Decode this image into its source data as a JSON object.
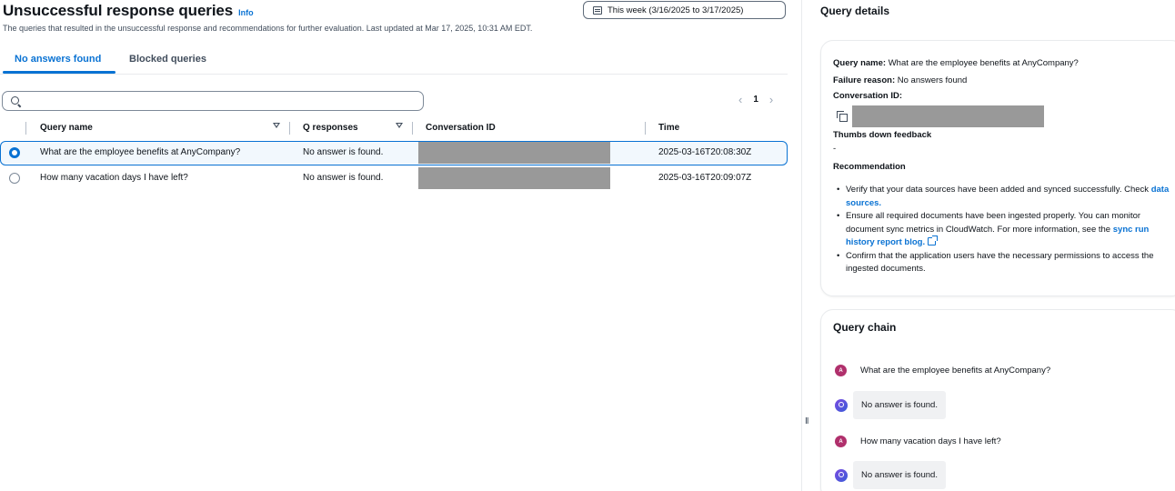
{
  "header": {
    "title": "Unsuccessful response queries",
    "info_label": "Info",
    "subtitle": "The queries that resulted in the unsuccessful response and recommendations for further evaluation. Last updated at Mar 17, 2025, 10:31 AM EDT.",
    "date_range_label": "This week (3/16/2025 to 3/17/2025)"
  },
  "tabs": [
    {
      "label": "No answers found",
      "active": true
    },
    {
      "label": "Blocked queries",
      "active": false
    }
  ],
  "search": {
    "placeholder": "",
    "value": ""
  },
  "pagination": {
    "prev": "‹",
    "page": "1",
    "next": "›"
  },
  "table": {
    "columns": [
      "Query name",
      "Q responses",
      "Conversation ID",
      "Time"
    ],
    "rows": [
      {
        "query_name": "What are the employee benefits at AnyCompany?",
        "q_response": "No answer is found.",
        "conversation_id": "",
        "time": "2025-03-16T20:08:30Z",
        "selected": true
      },
      {
        "query_name": "How many vacation days I have left?",
        "q_response": "No answer is found.",
        "conversation_id": "",
        "time": "2025-03-16T20:09:07Z",
        "selected": false
      }
    ]
  },
  "details": {
    "title": "Query details",
    "query_name_label": "Query name:",
    "query_name_value": "What are the employee benefits at AnyCompany?",
    "failure_reason_label": "Failure reason:",
    "failure_reason_value": "No answers found",
    "conversation_id_label": "Conversation ID:",
    "thumbs_down_label": "Thumbs down feedback",
    "thumbs_down_value": "-",
    "recommendation_label": "Recommendation",
    "recommendations": {
      "r1_text": "Verify that your data sources have been added and synced successfully. Check",
      "r1_link": "data sources.",
      "r2_text": "Ensure all required documents have been ingested properly. You can monitor document sync metrics in CloudWatch. For more information, see the",
      "r2_link": "sync run history report blog.",
      "r3_text": "Confirm that the application users have the necessary permissions to access the ingested documents."
    }
  },
  "query_chain": {
    "title": "Query chain",
    "user_initial": "A",
    "messages": [
      {
        "role": "user",
        "text": "What are the employee benefits at AnyCompany?"
      },
      {
        "role": "assistant",
        "text": "No answer is found."
      },
      {
        "role": "user",
        "text": "How many vacation days I have left?"
      },
      {
        "role": "assistant",
        "text": "No answer is found."
      }
    ]
  },
  "splitter": {
    "handle": "II"
  },
  "colors": {
    "accent": "#0972d3",
    "user_avatar": "#b0306c",
    "redaction": "#999999"
  }
}
